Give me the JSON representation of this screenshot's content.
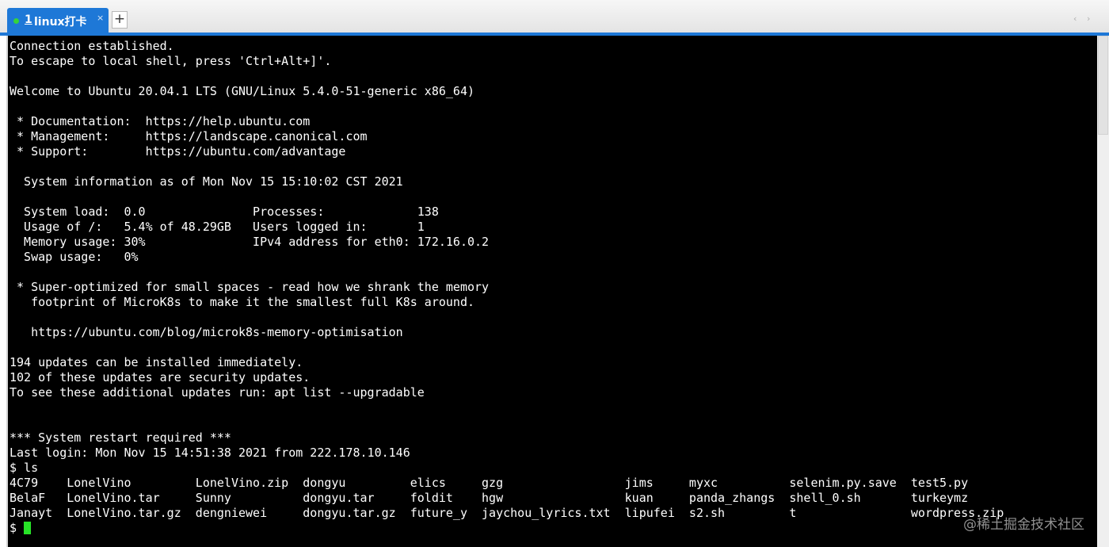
{
  "tab": {
    "number": "1",
    "title": "linux打卡",
    "close_glyph": "×",
    "status_color": "#36d43a"
  },
  "toolbar": {
    "new_tab_label": "+",
    "nav_left_icon": "‹",
    "nav_right_icon": "›"
  },
  "terminal": {
    "lines": [
      "Connection established.",
      "To escape to local shell, press 'Ctrl+Alt+]'.",
      "",
      "Welcome to Ubuntu 20.04.1 LTS (GNU/Linux 5.4.0-51-generic x86_64)",
      "",
      " * Documentation:  https://help.ubuntu.com",
      " * Management:     https://landscape.canonical.com",
      " * Support:        https://ubuntu.com/advantage",
      "",
      "  System information as of Mon Nov 15 15:10:02 CST 2021",
      "",
      "  System load:  0.0               Processes:             138",
      "  Usage of /:   5.4% of 48.29GB   Users logged in:       1",
      "  Memory usage: 30%               IPv4 address for eth0: 172.16.0.2",
      "  Swap usage:   0%",
      "",
      " * Super-optimized for small spaces - read how we shrank the memory",
      "   footprint of MicroK8s to make it the smallest full K8s around.",
      "",
      "   https://ubuntu.com/blog/microk8s-memory-optimisation",
      "",
      "194 updates can be installed immediately.",
      "102 of these updates are security updates.",
      "To see these additional updates run: apt list --upgradable",
      "",
      "",
      "*** System restart required ***",
      "Last login: Mon Nov 15 14:51:38 2021 from 222.178.10.146",
      "$ ls",
      "4C79    LonelVino         LonelVino.zip  dongyu         elics     gzg                 jims     myxc          selenim.py.save  test5.py",
      "BelaF   LonelVino.tar     Sunny          dongyu.tar     foldit    hgw                 kuan     panda_zhangs  shell_0.sh       turkeymz",
      "Janayt  LonelVino.tar.gz  dengniewei     dongyu.tar.gz  future_y  jaychou_lyrics.txt  lipufei  s2.sh         t                wordpress.zip"
    ],
    "prompt": "$ ",
    "cursor_color": "#27e327"
  },
  "watermark": "@稀土掘金技术社区"
}
